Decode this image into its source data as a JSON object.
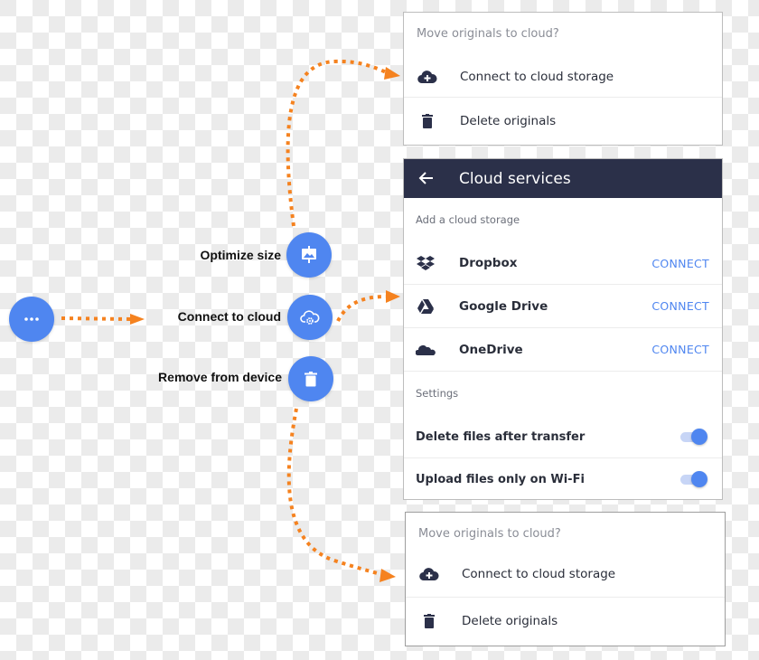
{
  "fab_menu": {
    "main_button_icon": "more-horizontal-icon",
    "actions": [
      {
        "label": "Optimize size",
        "icon": "image-presentation-icon"
      },
      {
        "label": "Connect to cloud",
        "icon": "cloud-settings-icon"
      },
      {
        "label": "Remove from device",
        "icon": "trash-icon"
      }
    ]
  },
  "dialog_top": {
    "caption": "Move originals to cloud?",
    "items": [
      {
        "label": "Connect to cloud storage",
        "icon": "cloud-upload-icon"
      },
      {
        "label": "Delete originals",
        "icon": "trash-icon"
      }
    ]
  },
  "cloud_services": {
    "title": "Cloud services",
    "back_icon": "arrow-left-icon",
    "storage_section_label": "Add a cloud storage",
    "services": [
      {
        "name": "Dropbox",
        "icon": "dropbox-icon",
        "action": "CONNECT"
      },
      {
        "name": "Google Drive",
        "icon": "google-drive-icon",
        "action": "CONNECT"
      },
      {
        "name": "OneDrive",
        "icon": "onedrive-icon",
        "action": "CONNECT"
      }
    ],
    "settings_section_label": "Settings",
    "settings": [
      {
        "label": "Delete files after transfer",
        "enabled": true
      },
      {
        "label": "Upload files only on Wi-Fi",
        "enabled": true
      }
    ]
  },
  "dialog_bottom": {
    "caption": "Move originals to cloud?",
    "items": [
      {
        "label": "Connect to cloud storage",
        "icon": "cloud-upload-icon"
      },
      {
        "label": "Delete originals",
        "icon": "trash-icon"
      }
    ]
  },
  "colors": {
    "accent": "#4f86f0",
    "header": "#2b3049",
    "arrow": "#f5821f",
    "text": "#2a2e3a"
  }
}
